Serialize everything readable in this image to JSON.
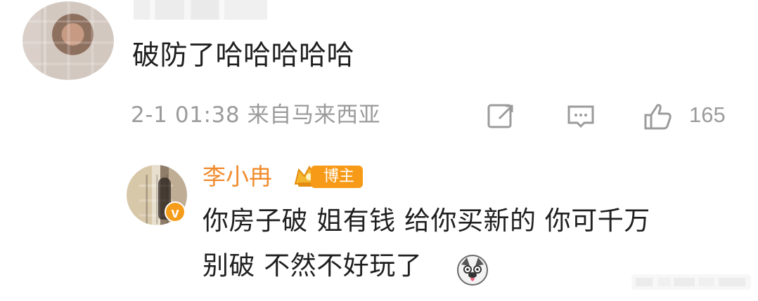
{
  "comment": {
    "text": "破防了哈哈哈哈哈",
    "meta": "2-1 01:38 来自马来西亚",
    "like_count": "165"
  },
  "reply": {
    "name": "李小冉",
    "role_badge": "博主",
    "line1": "你房子破 姐有钱 给你买新的 你可千万",
    "line2": "别破 不然不好玩了",
    "verified_mark": "v"
  },
  "icons": {
    "share": "share-icon",
    "comment": "comment-icon",
    "like": "thumbs-up-icon",
    "crown": "crown-icon",
    "emoji": "husky-emoji-icon"
  },
  "colors": {
    "name_accent": "#f08b2d",
    "badge": "#f79a18",
    "meta_gray": "#9b9b9b"
  }
}
